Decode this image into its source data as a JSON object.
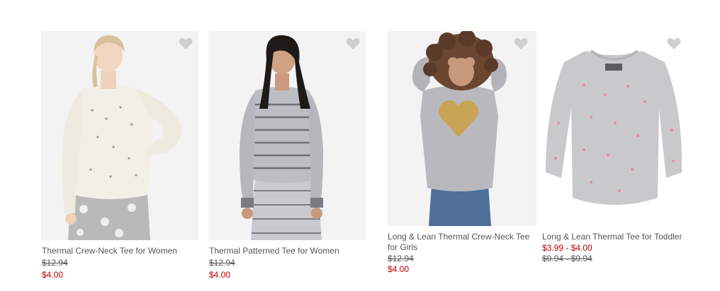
{
  "products": [
    {
      "title": "Thermal Crew-Neck Tee for Women",
      "regular_price": "$12.94",
      "sale_price": "$4.00",
      "favorite_icon": "heart-icon"
    },
    {
      "title": "Thermal Patterned Tee for Women",
      "regular_price": "$12.94",
      "sale_price": "$4.00",
      "favorite_icon": "heart-icon"
    },
    {
      "title": "Long & Lean Thermal Crew-Neck Tee for Girls",
      "regular_price": "$12.94",
      "sale_price": "$4.00",
      "favorite_icon": "heart-icon"
    },
    {
      "title": "Long & Lean Thermal Tee for Toddler",
      "sale_price": "$3.99 - $4.00",
      "regular_price": "$9.94 - $9.94",
      "favorite_icon": "heart-icon"
    }
  ],
  "colors": {
    "sale": "#c00000",
    "text": "#555555",
    "heart": "#cfcfcf"
  }
}
